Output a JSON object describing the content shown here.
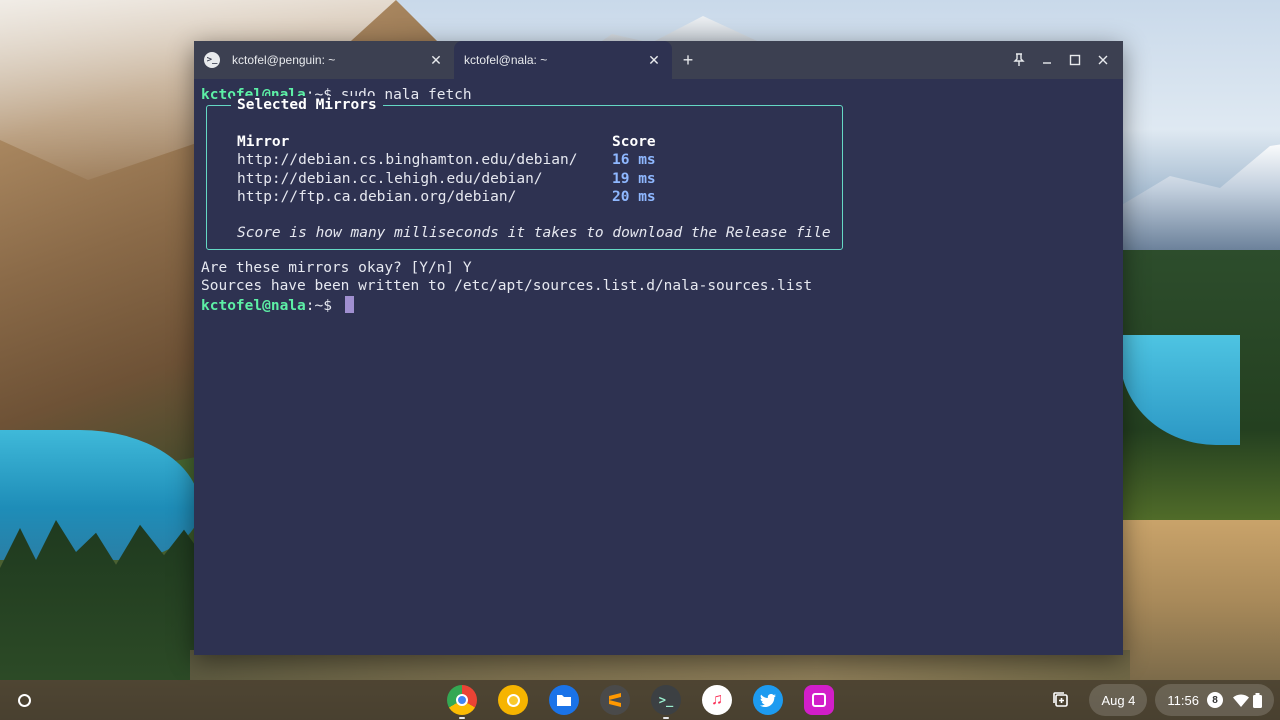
{
  "window": {
    "tabs": [
      {
        "title": "kctofel@penguin: ~",
        "active": false
      },
      {
        "title": "kctofel@nala: ~",
        "active": true
      }
    ],
    "new_tab_icon": "+",
    "close_icon": "✕"
  },
  "terminal": {
    "prompt_user": "kctofel@nala",
    "prompt_suffix": ":~$ ",
    "command": "sudo nala fetch",
    "box_title": "Selected Mirrors",
    "headers": {
      "mirror": "Mirror",
      "score": "Score"
    },
    "mirrors": [
      {
        "url": "http://debian.cs.binghamton.edu/debian/",
        "score": "16 ms"
      },
      {
        "url": "http://debian.cc.lehigh.edu/debian/",
        "score": "19 ms"
      },
      {
        "url": "http://ftp.ca.debian.org/debian/",
        "score": "20 ms"
      }
    ],
    "note": "Score is how many milliseconds it takes to download the Release file",
    "question": "Are these mirrors okay? [Y/n] Y",
    "result": "Sources have been written to /etc/apt/sources.list.d/nala-sources.list",
    "final_prompt_user": "kctofel@nala",
    "final_prompt_suffix": ":~$ "
  },
  "shelf": {
    "apps": [
      {
        "name": "chrome",
        "color": "#ea4335"
      },
      {
        "name": "chrome-canary",
        "color": "#f6b400"
      },
      {
        "name": "files",
        "color": "#1a73e8"
      },
      {
        "name": "sublime",
        "color": "#4a4a4a"
      },
      {
        "name": "terminal",
        "color": "#3c4043",
        "glyph": ">_"
      },
      {
        "name": "music",
        "color": "#ffffff"
      },
      {
        "name": "twitter",
        "color": "#1d9bf0"
      },
      {
        "name": "photos",
        "color": "#d21ec9"
      }
    ],
    "date": "Aug 4",
    "time": "11:56",
    "notification_count": "8"
  }
}
